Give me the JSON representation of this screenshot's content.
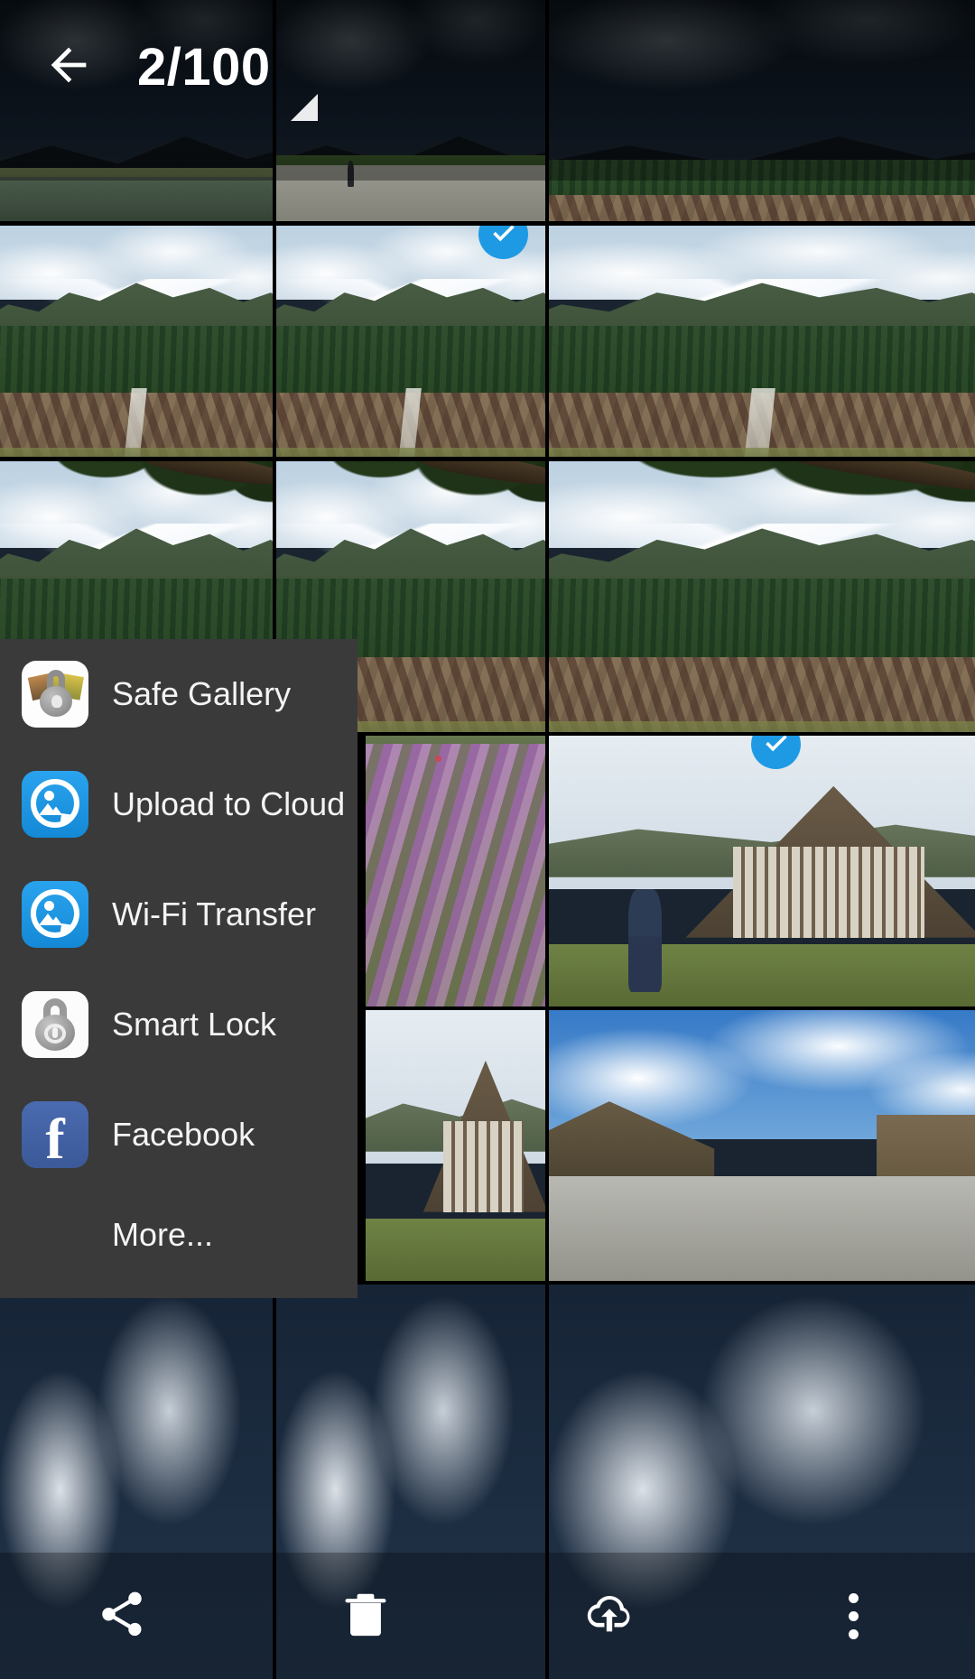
{
  "app": {
    "screen_name": "gallery-multi-select",
    "accent_color": "#1e9ae4",
    "menu_background": "#3a3a3a"
  },
  "header": {
    "back_icon": "arrow-left-icon",
    "selection_count": "2/100",
    "selected": 2,
    "total": 100
  },
  "share_menu": {
    "items": [
      {
        "label": "Safe Gallery",
        "icon": "safe-gallery-icon"
      },
      {
        "label": "Upload to Cloud",
        "icon": "upload-to-cloud-icon"
      },
      {
        "label": "Wi-Fi Transfer",
        "icon": "wifi-transfer-icon"
      },
      {
        "label": "Smart Lock",
        "icon": "smart-lock-icon"
      },
      {
        "label": "Facebook",
        "icon": "facebook-icon"
      }
    ],
    "more_label": "More..."
  },
  "bottom_toolbar": {
    "buttons": [
      {
        "name": "share-button",
        "icon": "share-icon"
      },
      {
        "name": "delete-button",
        "icon": "trash-icon"
      },
      {
        "name": "upload-button",
        "icon": "cloud-upload-icon"
      },
      {
        "name": "overflow-button",
        "icon": "more-vertical-icon"
      }
    ]
  },
  "photo_grid": {
    "columns": 3,
    "selected_tile_indices": [
      4,
      14
    ],
    "tiles": [
      {
        "scene": "dark-village-dusk",
        "selected": false
      },
      {
        "scene": "dark-road-walker",
        "selected": false
      },
      {
        "scene": "dark-village-aerial",
        "selected": false
      },
      {
        "scene": "village-aerial-snowcap",
        "selected": false
      },
      {
        "scene": "village-aerial-snowcap",
        "selected": true
      },
      {
        "scene": "village-aerial-snowcap",
        "selected": false
      },
      {
        "scene": "village-aerial-pine-branch",
        "selected": false
      },
      {
        "scene": "village-aerial-pine-branch",
        "selected": false
      },
      {
        "scene": "village-aerial-pine-branch",
        "selected": false
      },
      {
        "scene": "village-aerial-snowcap",
        "selected": false
      },
      {
        "scene": "purple-flower-field",
        "selected": false
      },
      {
        "scene": "gassho-farmhouse-visitor",
        "selected": true
      },
      {
        "scene": "village-aerial-snowcap",
        "selected": false
      },
      {
        "scene": "gassho-farmhouse",
        "selected": false
      },
      {
        "scene": "village-street-clouds",
        "selected": false
      },
      {
        "scene": "cloudy-sky-dark",
        "selected": false
      },
      {
        "scene": "cloudy-sky-dark",
        "selected": false
      },
      {
        "scene": "cloudy-sky-dark",
        "selected": false
      }
    ]
  }
}
